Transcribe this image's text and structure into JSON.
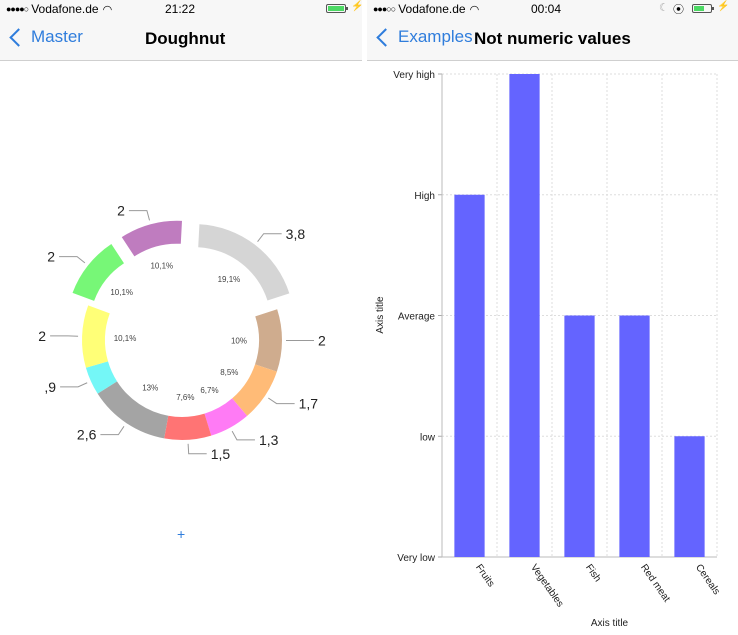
{
  "left_screen": {
    "status_bar": {
      "signal": "●●●●○",
      "carrier": "Vodafone.de",
      "wifi_icon": "wifi-icon",
      "time": "21:22",
      "battery_level": 1.0
    },
    "nav": {
      "back_label": "Master",
      "title": "Doughnut"
    },
    "add_button_label": "+"
  },
  "right_screen": {
    "status_bar": {
      "signal": "●●●○○",
      "carrier": "Vodafone.de",
      "wifi_icon": "wifi-icon",
      "time": "00:04",
      "do_not_disturb_icon": "moon-icon",
      "rotation_lock_icon": "rotation-lock-icon",
      "battery_level": 0.6
    },
    "nav": {
      "back_label": "Examples",
      "title": "Not numeric values"
    }
  },
  "chart_data": [
    {
      "type": "pie",
      "variant": "doughnut",
      "title": "Doughnut",
      "slices": [
        {
          "value": 3.8,
          "value_label": "3,8",
          "percent_label": "19,1%",
          "color": "#d5d5d5",
          "exploded": true
        },
        {
          "value": 2,
          "value_label": "2",
          "percent_label": "10%",
          "color": "#cfac8e",
          "exploded": false
        },
        {
          "value": 1.7,
          "value_label": "1,7",
          "percent_label": "8,5%",
          "color": "#ffbb77",
          "exploded": false
        },
        {
          "value": 1.3,
          "value_label": "1,3",
          "percent_label": "6,7%",
          "color": "#ff7bf5",
          "exploded": false
        },
        {
          "value": 1.5,
          "value_label": "1,5",
          "percent_label": "7,6%",
          "color": "#ff7474",
          "exploded": false
        },
        {
          "value": 2.6,
          "value_label": "2,6",
          "percent_label": "13%",
          "color": "#a4a4a4",
          "exploded": false
        },
        {
          "value": 0.9,
          "value_label": ",9",
          "percent_label": "",
          "color": "#74f7f7",
          "exploded": false
        },
        {
          "value": 2,
          "value_label": "2",
          "percent_label": "10,1%",
          "color": "#ffff77",
          "exploded": false
        },
        {
          "value": 2,
          "value_label": "2",
          "percent_label": "10,1%",
          "color": "#77f777",
          "exploded": true
        },
        {
          "value": 2,
          "value_label": "2",
          "percent_label": "10,1%",
          "color": "#bf7cbf",
          "exploded": true
        }
      ]
    },
    {
      "type": "bar",
      "title": "Not numeric values",
      "categories": [
        "Fruits",
        "Vegetables",
        "Fish",
        "Red meat",
        "Cereals"
      ],
      "y_categories": [
        "Very low",
        "low",
        "Average",
        "High",
        "Very high"
      ],
      "values": [
        "High",
        "Very high",
        "Average",
        "Average",
        "low"
      ],
      "xlabel": "Axis title",
      "ylabel": "Axis title",
      "bar_color": "#6464ff",
      "grid": true
    }
  ]
}
